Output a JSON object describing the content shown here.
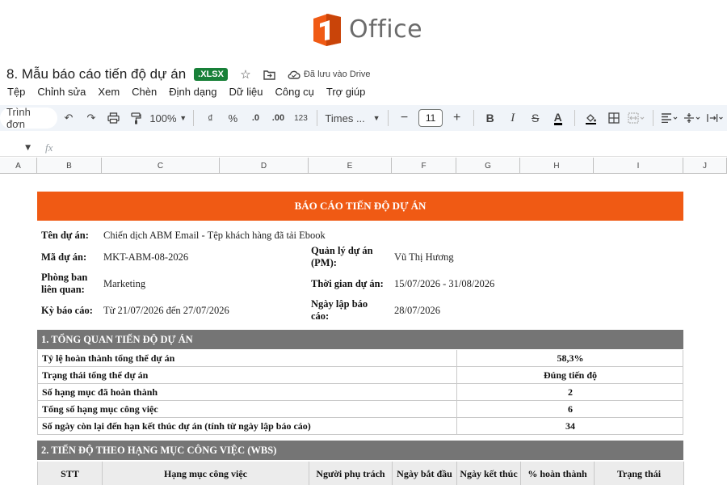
{
  "logo": {
    "text": "Office",
    "mark_char": "1",
    "mark_color": "#f05a14"
  },
  "document": {
    "title": "8. Mẫu báo cáo tiến độ dự án",
    "format_badge": ".XLSX",
    "saved_status": "Đã lưu vào Drive"
  },
  "menu": [
    "Tệp",
    "Chỉnh sửa",
    "Xem",
    "Chèn",
    "Định dạng",
    "Dữ liệu",
    "Công cụ",
    "Trợ giúp"
  ],
  "toolbar": {
    "mode_label": "Trình đơn",
    "zoom": "100%",
    "currency": "₫",
    "percent": "%",
    "decrease_decimal": ".0",
    "increase_decimal": ".00",
    "number_format": "123",
    "font_family": "Times ...",
    "font_size": "11",
    "bold": "B",
    "italic": "I",
    "strike": "S",
    "text_color": "A"
  },
  "formula_bar": {
    "fx": "fx"
  },
  "columns": [
    "A",
    "B",
    "C",
    "D",
    "E",
    "F",
    "G",
    "H",
    "I",
    "J"
  ],
  "report": {
    "banner": "BÁO CÁO TIẾN ĐỘ DỰ ÁN",
    "info": {
      "project_name_label": "Tên dự án:",
      "project_name": "Chiến dịch ABM Email - Tệp khách hàng đã tải Ebook",
      "project_code_label": "Mã dự án:",
      "project_code": "MKT-ABM-08-2026",
      "pm_label_1": "Quản lý dự án",
      "pm_label_2": "(PM):",
      "pm": "Vũ Thị Hương",
      "dept_label_1": "Phòng ban",
      "dept_label_2": "liên quan:",
      "dept": "Marketing",
      "duration_label": "Thời gian dự án:",
      "duration": "15/07/2026 - 31/08/2026",
      "period_label": "Kỳ báo cáo:",
      "period": "Từ 21/07/2026 đến 27/07/2026",
      "created_label_1": "Ngày lập báo",
      "created_label_2": "cáo:",
      "created": "28/07/2026"
    },
    "section1": {
      "title": "1. TỔNG QUAN TIẾN ĐỘ DỰ ÁN",
      "rows": [
        {
          "label": "Tỷ lệ hoàn thành tổng thể dự án",
          "value": "58,3%"
        },
        {
          "label": "Trạng thái tổng thể dự án",
          "value": "Đúng tiến độ"
        },
        {
          "label": "Số hạng mục đã hoàn thành",
          "value": "2"
        },
        {
          "label": "Tổng số hạng mục công việc",
          "value": "6"
        },
        {
          "label": "Số ngày còn lại đến hạn kết thúc dự án (tính từ ngày lập báo cáo)",
          "value": "34"
        }
      ]
    },
    "section2": {
      "title": "2. TIẾN ĐỘ THEO HẠNG MỤC CÔNG VIỆC (WBS)",
      "headers": [
        "STT",
        "Hạng mục công việc",
        "Người phụ trách",
        "Ngày bắt đầu",
        "Ngày kết thúc",
        "% hoàn thành",
        "Trạng thái"
      ]
    }
  }
}
